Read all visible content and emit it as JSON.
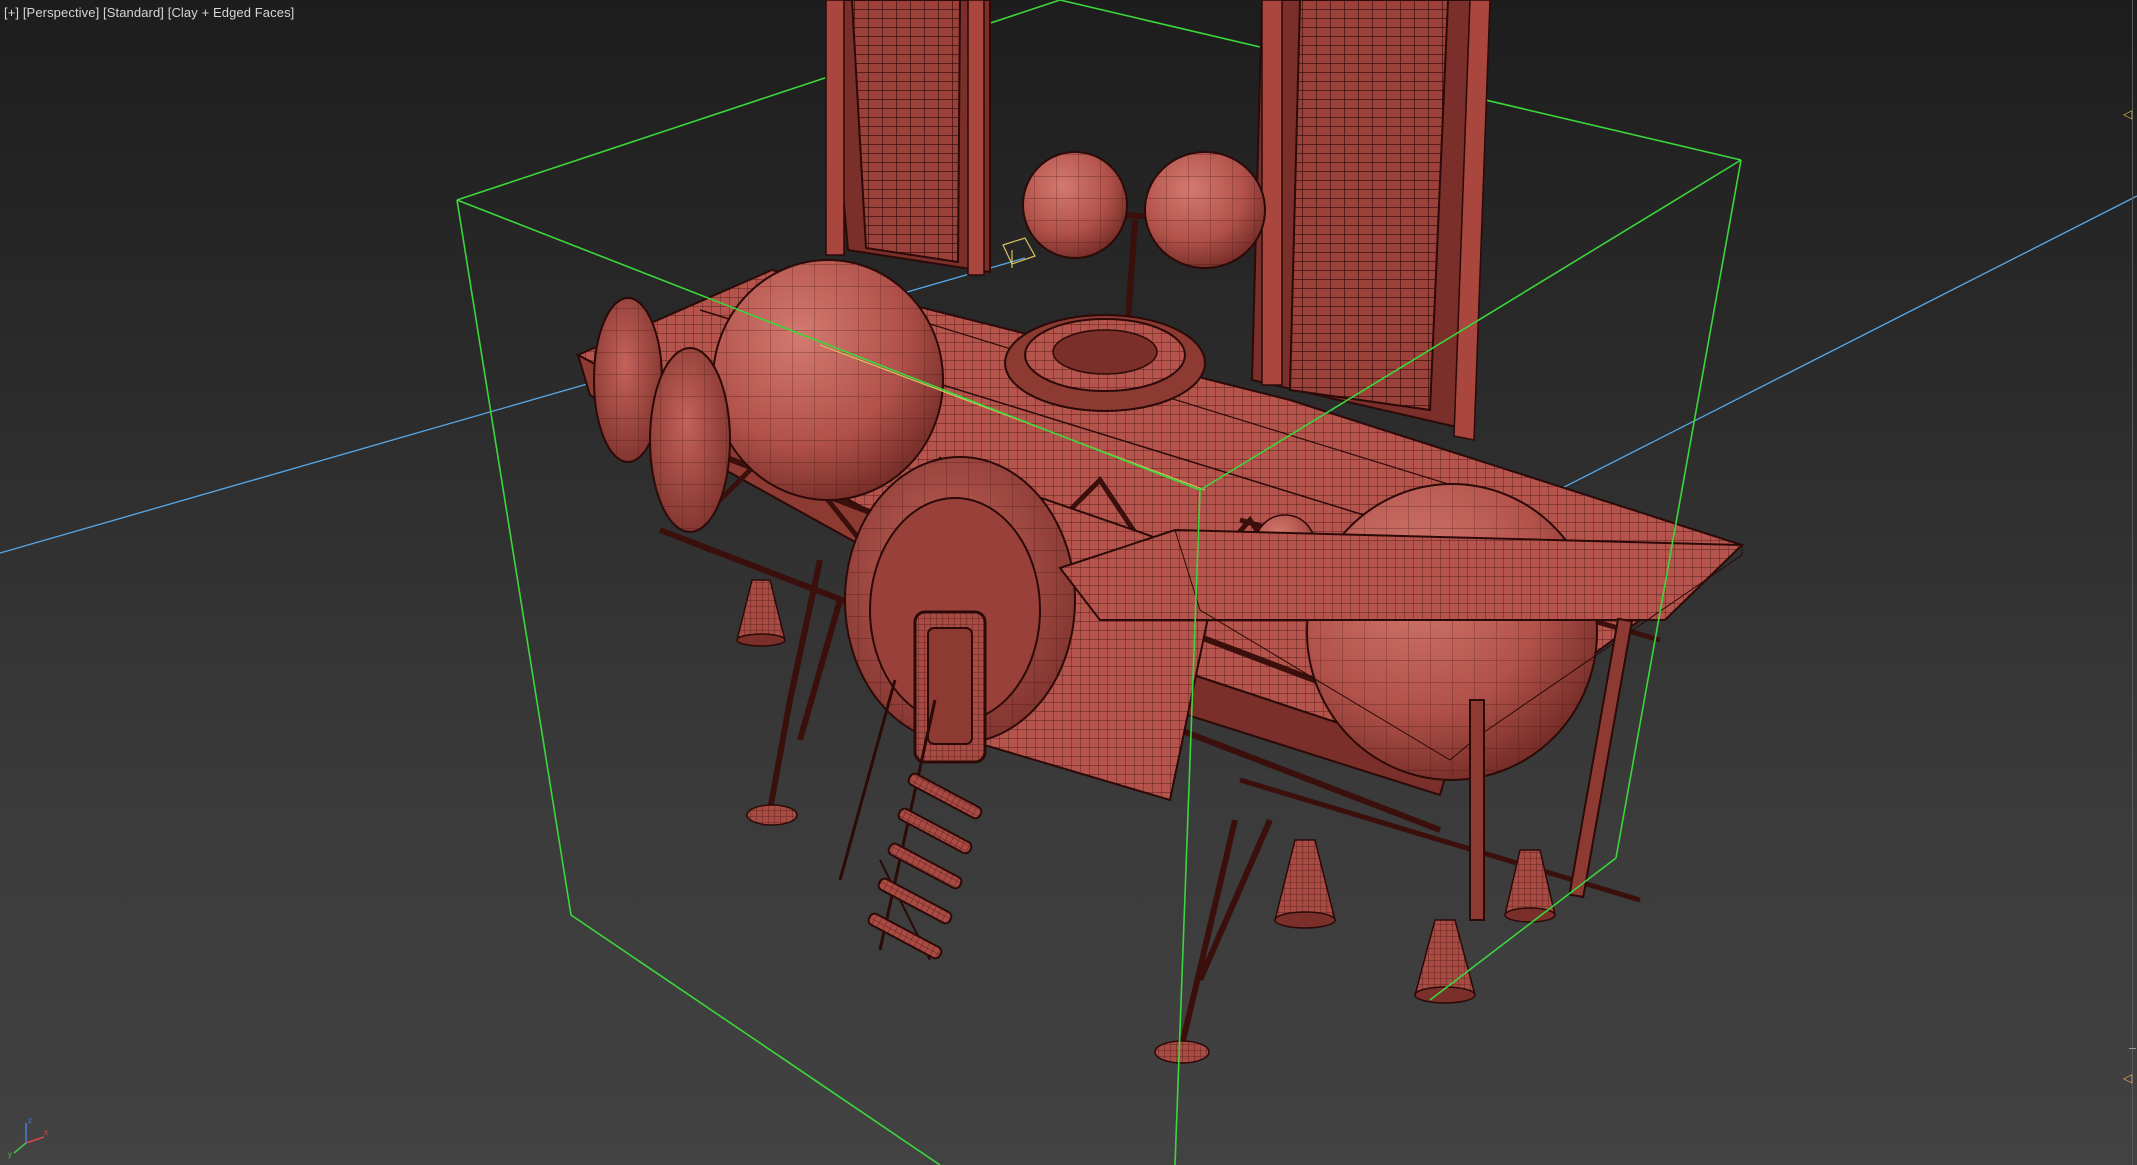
{
  "viewport": {
    "label_parts": [
      "[+]",
      "[Perspective]",
      "[Standard]",
      "[Clay + Edged Faces]"
    ],
    "label_separator": " "
  },
  "colors": {
    "background_top": "#1d1d1d",
    "background_bottom": "#424242",
    "selection_bbox": "#3bd63b",
    "grid_axis": "#5aa8e6",
    "clay_fill": "#b5544c",
    "clay_dark": "#7a2f2a",
    "edge_wire": "#3a0f0c",
    "ruler_marker": "#e0b54a"
  },
  "gizmo": {
    "axes": [
      "x",
      "y",
      "z"
    ],
    "axis_colors": [
      "#e04545",
      "#45c445",
      "#4a7de0"
    ]
  },
  "ruler": {
    "marker_icon": "triangle-left-icon"
  }
}
